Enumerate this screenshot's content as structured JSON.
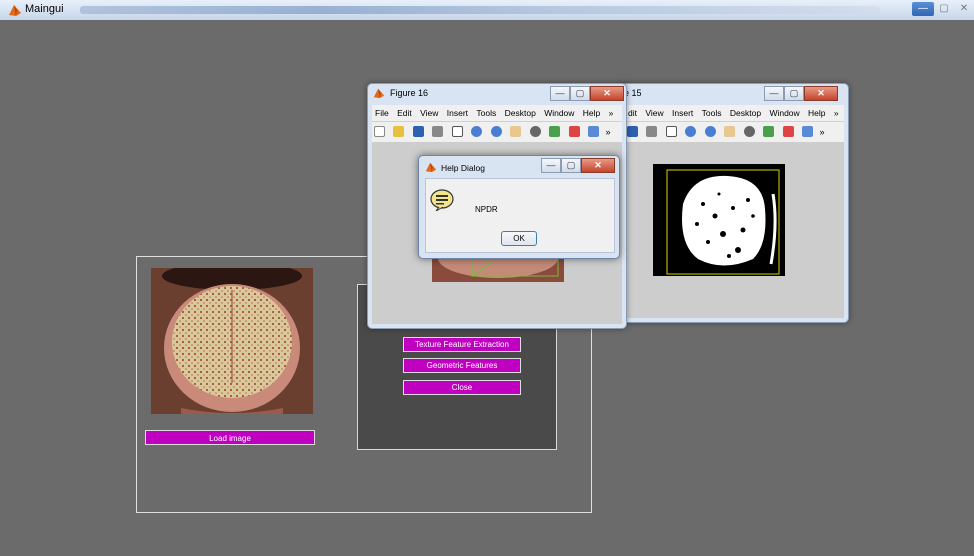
{
  "main_window": {
    "title": "Maingui",
    "controls": {
      "minimize": "—",
      "maximize": "▢",
      "close": "✕"
    }
  },
  "buttons": {
    "load_image": "Load  image",
    "texture_feature_extraction": "Texture Feature Extraction",
    "geometric_features": "Geometric Features",
    "close": "Close"
  },
  "figure16": {
    "title": "Figure 16",
    "menu": [
      "File",
      "Edit",
      "View",
      "Insert",
      "Tools",
      "Desktop",
      "Window",
      "Help",
      "»"
    ],
    "controls": {
      "minimize": "—",
      "maximize": "▢",
      "close": "✕"
    },
    "toolbar_more": "»"
  },
  "figure15": {
    "title_fragment": "e 15",
    "menu": [
      "dit",
      "View",
      "Insert",
      "Tools",
      "Desktop",
      "Window",
      "Help",
      "»"
    ],
    "controls": {
      "minimize": "—",
      "maximize": "▢",
      "close": "✕"
    },
    "toolbar_more": "»"
  },
  "help_dialog": {
    "title": "Help Dialog",
    "message": "NPDR",
    "ok_label": "OK",
    "controls": {
      "minimize": "—",
      "maximize": "▢",
      "close": "✕"
    }
  },
  "colors": {
    "desktop_bg": "#6b6b6b",
    "button_magenta": "#c000c0",
    "inner_panel": "#4a4a4a",
    "figure_canvas": "#cdcdcd"
  },
  "icons": [
    "matlab-icon",
    "new-file-icon",
    "open-folder-icon",
    "save-icon",
    "print-icon",
    "pointer-icon",
    "zoom-in-icon",
    "zoom-out-icon",
    "pan-icon",
    "rotate-icon",
    "data-cursor-icon",
    "brush-icon",
    "colorbar-icon",
    "help-bubble-icon"
  ]
}
